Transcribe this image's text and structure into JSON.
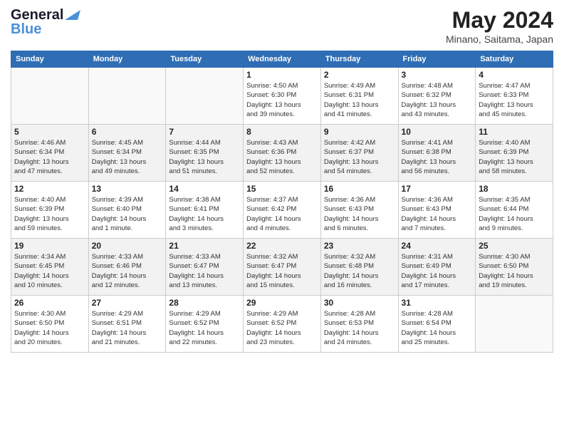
{
  "header": {
    "logo_line1": "General",
    "logo_line2": "Blue",
    "month_year": "May 2024",
    "location": "Minano, Saitama, Japan"
  },
  "weekdays": [
    "Sunday",
    "Monday",
    "Tuesday",
    "Wednesday",
    "Thursday",
    "Friday",
    "Saturday"
  ],
  "weeks": [
    {
      "shade": false,
      "days": [
        {
          "num": "",
          "info": ""
        },
        {
          "num": "",
          "info": ""
        },
        {
          "num": "",
          "info": ""
        },
        {
          "num": "1",
          "info": "Sunrise: 4:50 AM\nSunset: 6:30 PM\nDaylight: 13 hours\nand 39 minutes."
        },
        {
          "num": "2",
          "info": "Sunrise: 4:49 AM\nSunset: 6:31 PM\nDaylight: 13 hours\nand 41 minutes."
        },
        {
          "num": "3",
          "info": "Sunrise: 4:48 AM\nSunset: 6:32 PM\nDaylight: 13 hours\nand 43 minutes."
        },
        {
          "num": "4",
          "info": "Sunrise: 4:47 AM\nSunset: 6:33 PM\nDaylight: 13 hours\nand 45 minutes."
        }
      ]
    },
    {
      "shade": true,
      "days": [
        {
          "num": "5",
          "info": "Sunrise: 4:46 AM\nSunset: 6:34 PM\nDaylight: 13 hours\nand 47 minutes."
        },
        {
          "num": "6",
          "info": "Sunrise: 4:45 AM\nSunset: 6:34 PM\nDaylight: 13 hours\nand 49 minutes."
        },
        {
          "num": "7",
          "info": "Sunrise: 4:44 AM\nSunset: 6:35 PM\nDaylight: 13 hours\nand 51 minutes."
        },
        {
          "num": "8",
          "info": "Sunrise: 4:43 AM\nSunset: 6:36 PM\nDaylight: 13 hours\nand 52 minutes."
        },
        {
          "num": "9",
          "info": "Sunrise: 4:42 AM\nSunset: 6:37 PM\nDaylight: 13 hours\nand 54 minutes."
        },
        {
          "num": "10",
          "info": "Sunrise: 4:41 AM\nSunset: 6:38 PM\nDaylight: 13 hours\nand 56 minutes."
        },
        {
          "num": "11",
          "info": "Sunrise: 4:40 AM\nSunset: 6:39 PM\nDaylight: 13 hours\nand 58 minutes."
        }
      ]
    },
    {
      "shade": false,
      "days": [
        {
          "num": "12",
          "info": "Sunrise: 4:40 AM\nSunset: 6:39 PM\nDaylight: 13 hours\nand 59 minutes."
        },
        {
          "num": "13",
          "info": "Sunrise: 4:39 AM\nSunset: 6:40 PM\nDaylight: 14 hours\nand 1 minute."
        },
        {
          "num": "14",
          "info": "Sunrise: 4:38 AM\nSunset: 6:41 PM\nDaylight: 14 hours\nand 3 minutes."
        },
        {
          "num": "15",
          "info": "Sunrise: 4:37 AM\nSunset: 6:42 PM\nDaylight: 14 hours\nand 4 minutes."
        },
        {
          "num": "16",
          "info": "Sunrise: 4:36 AM\nSunset: 6:43 PM\nDaylight: 14 hours\nand 6 minutes."
        },
        {
          "num": "17",
          "info": "Sunrise: 4:36 AM\nSunset: 6:43 PM\nDaylight: 14 hours\nand 7 minutes."
        },
        {
          "num": "18",
          "info": "Sunrise: 4:35 AM\nSunset: 6:44 PM\nDaylight: 14 hours\nand 9 minutes."
        }
      ]
    },
    {
      "shade": true,
      "days": [
        {
          "num": "19",
          "info": "Sunrise: 4:34 AM\nSunset: 6:45 PM\nDaylight: 14 hours\nand 10 minutes."
        },
        {
          "num": "20",
          "info": "Sunrise: 4:33 AM\nSunset: 6:46 PM\nDaylight: 14 hours\nand 12 minutes."
        },
        {
          "num": "21",
          "info": "Sunrise: 4:33 AM\nSunset: 6:47 PM\nDaylight: 14 hours\nand 13 minutes."
        },
        {
          "num": "22",
          "info": "Sunrise: 4:32 AM\nSunset: 6:47 PM\nDaylight: 14 hours\nand 15 minutes."
        },
        {
          "num": "23",
          "info": "Sunrise: 4:32 AM\nSunset: 6:48 PM\nDaylight: 14 hours\nand 16 minutes."
        },
        {
          "num": "24",
          "info": "Sunrise: 4:31 AM\nSunset: 6:49 PM\nDaylight: 14 hours\nand 17 minutes."
        },
        {
          "num": "25",
          "info": "Sunrise: 4:30 AM\nSunset: 6:50 PM\nDaylight: 14 hours\nand 19 minutes."
        }
      ]
    },
    {
      "shade": false,
      "days": [
        {
          "num": "26",
          "info": "Sunrise: 4:30 AM\nSunset: 6:50 PM\nDaylight: 14 hours\nand 20 minutes."
        },
        {
          "num": "27",
          "info": "Sunrise: 4:29 AM\nSunset: 6:51 PM\nDaylight: 14 hours\nand 21 minutes."
        },
        {
          "num": "28",
          "info": "Sunrise: 4:29 AM\nSunset: 6:52 PM\nDaylight: 14 hours\nand 22 minutes."
        },
        {
          "num": "29",
          "info": "Sunrise: 4:29 AM\nSunset: 6:52 PM\nDaylight: 14 hours\nand 23 minutes."
        },
        {
          "num": "30",
          "info": "Sunrise: 4:28 AM\nSunset: 6:53 PM\nDaylight: 14 hours\nand 24 minutes."
        },
        {
          "num": "31",
          "info": "Sunrise: 4:28 AM\nSunset: 6:54 PM\nDaylight: 14 hours\nand 25 minutes."
        },
        {
          "num": "",
          "info": ""
        }
      ]
    }
  ]
}
